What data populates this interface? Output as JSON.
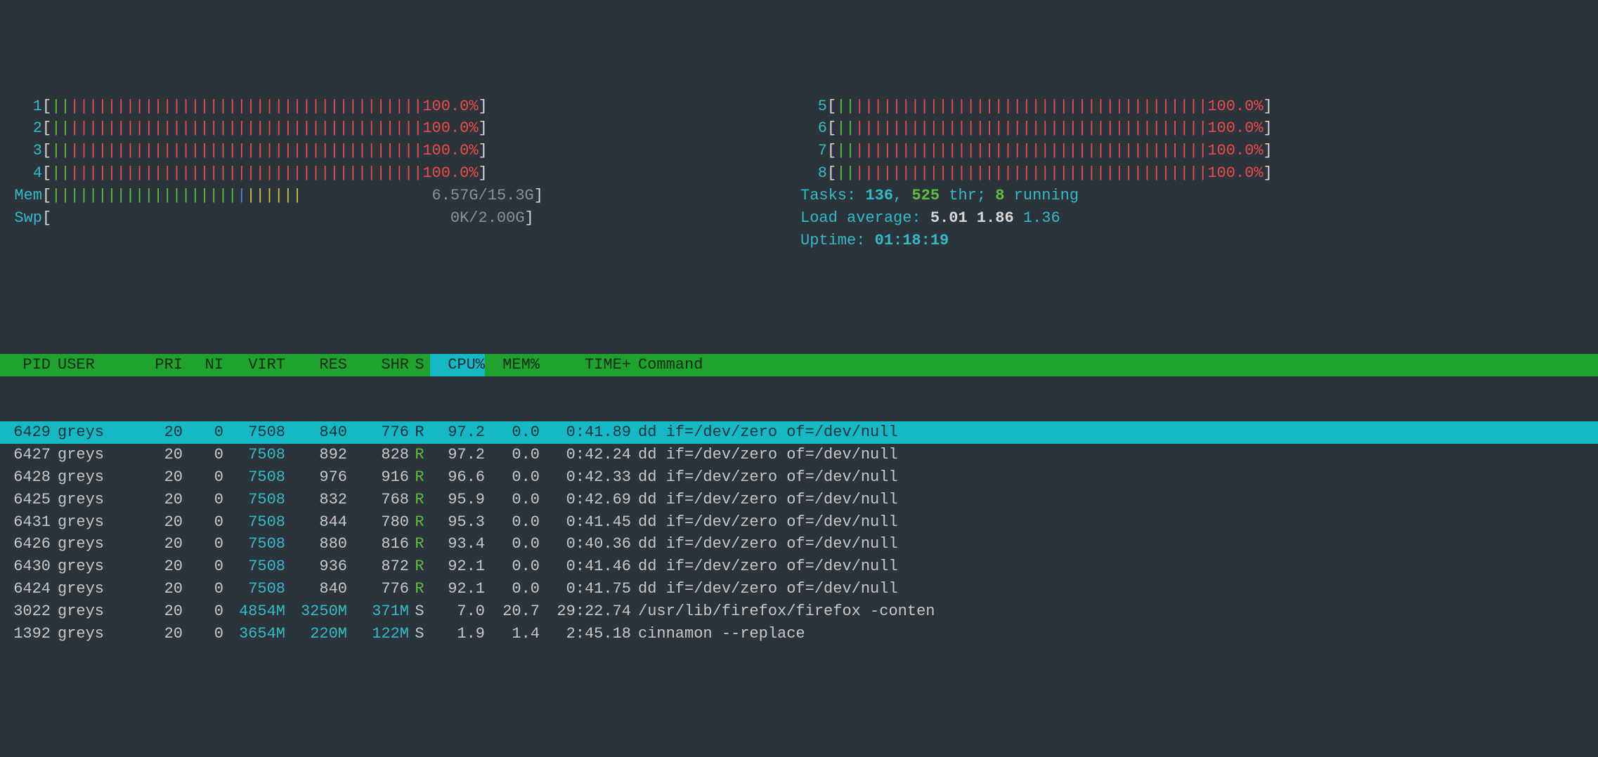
{
  "cpus_left": [
    {
      "id": "1",
      "pct": "100.0%"
    },
    {
      "id": "2",
      "pct": "100.0%"
    },
    {
      "id": "3",
      "pct": "100.0%"
    },
    {
      "id": "4",
      "pct": "100.0%"
    }
  ],
  "cpus_right": [
    {
      "id": "5",
      "pct": "100.0%"
    },
    {
      "id": "6",
      "pct": "100.0%"
    },
    {
      "id": "7",
      "pct": "100.0%"
    },
    {
      "id": "8",
      "pct": "100.0%"
    }
  ],
  "mem": {
    "label": "Mem",
    "value": "6.57G/15.3G"
  },
  "swp": {
    "label": "Swp",
    "value": "0K/2.00G"
  },
  "tasksLabel": "Tasks: ",
  "tasksCount": "136",
  "tasksSep": ", ",
  "thrCount": "525",
  "thrLabel": " thr; ",
  "runCount": "8",
  "runLabel": " running",
  "loadLabel": "Load average: ",
  "load1": "5.01",
  "load5": "1.86",
  "load15": "1.36",
  "uptimeLabel": "Uptime: ",
  "uptime": "01:18:19",
  "headers": {
    "pid": "PID",
    "user": "USER",
    "pri": "PRI",
    "ni": "NI",
    "virt": "VIRT",
    "res": "RES",
    "shr": "SHR",
    "s": "S",
    "cpu": "CPU%",
    "mem": "MEM%",
    "time": "TIME+",
    "cmd": "Command"
  },
  "procs": [
    {
      "pid": "6429",
      "user": "greys",
      "pri": "20",
      "ni": "0",
      "virt": "7508",
      "res": "840",
      "shr": "776",
      "s": "R",
      "cpu": "97.2",
      "mem": "0.0",
      "time": "0:41.89",
      "cmd": "dd if=/dev/zero of=/dev/null",
      "sel": true,
      "hi": false
    },
    {
      "pid": "6427",
      "user": "greys",
      "pri": "20",
      "ni": "0",
      "virt": "7508",
      "res": "892",
      "shr": "828",
      "s": "R",
      "cpu": "97.2",
      "mem": "0.0",
      "time": "0:42.24",
      "cmd": "dd if=/dev/zero of=/dev/null",
      "sel": false,
      "hi": true
    },
    {
      "pid": "6428",
      "user": "greys",
      "pri": "20",
      "ni": "0",
      "virt": "7508",
      "res": "976",
      "shr": "916",
      "s": "R",
      "cpu": "96.6",
      "mem": "0.0",
      "time": "0:42.33",
      "cmd": "dd if=/dev/zero of=/dev/null",
      "sel": false,
      "hi": true
    },
    {
      "pid": "6425",
      "user": "greys",
      "pri": "20",
      "ni": "0",
      "virt": "7508",
      "res": "832",
      "shr": "768",
      "s": "R",
      "cpu": "95.9",
      "mem": "0.0",
      "time": "0:42.69",
      "cmd": "dd if=/dev/zero of=/dev/null",
      "sel": false,
      "hi": true
    },
    {
      "pid": "6431",
      "user": "greys",
      "pri": "20",
      "ni": "0",
      "virt": "7508",
      "res": "844",
      "shr": "780",
      "s": "R",
      "cpu": "95.3",
      "mem": "0.0",
      "time": "0:41.45",
      "cmd": "dd if=/dev/zero of=/dev/null",
      "sel": false,
      "hi": true
    },
    {
      "pid": "6426",
      "user": "greys",
      "pri": "20",
      "ni": "0",
      "virt": "7508",
      "res": "880",
      "shr": "816",
      "s": "R",
      "cpu": "93.4",
      "mem": "0.0",
      "time": "0:40.36",
      "cmd": "dd if=/dev/zero of=/dev/null",
      "sel": false,
      "hi": true
    },
    {
      "pid": "6430",
      "user": "greys",
      "pri": "20",
      "ni": "0",
      "virt": "7508",
      "res": "936",
      "shr": "872",
      "s": "R",
      "cpu": "92.1",
      "mem": "0.0",
      "time": "0:41.46",
      "cmd": "dd if=/dev/zero of=/dev/null",
      "sel": false,
      "hi": true
    },
    {
      "pid": "6424",
      "user": "greys",
      "pri": "20",
      "ni": "0",
      "virt": "7508",
      "res": "840",
      "shr": "776",
      "s": "R",
      "cpu": "92.1",
      "mem": "0.0",
      "time": "0:41.75",
      "cmd": "dd if=/dev/zero of=/dev/null",
      "sel": false,
      "hi": true
    },
    {
      "pid": "3022",
      "user": "greys",
      "pri": "20",
      "ni": "0",
      "virt": "4854M",
      "res": "3250M",
      "shr": "371M",
      "s": "S",
      "cpu": "7.0",
      "mem": "20.7",
      "time": "29:22.74",
      "cmd": "/usr/lib/firefox/firefox -conten",
      "sel": false,
      "hi": true
    },
    {
      "pid": "1392",
      "user": "greys",
      "pri": "20",
      "ni": "0",
      "virt": "3654M",
      "res": "220M",
      "shr": "122M",
      "s": "S",
      "cpu": "1.9",
      "mem": "1.4",
      "time": "2:45.18",
      "cmd": "cinnamon --replace",
      "sel": false,
      "hi": true
    }
  ]
}
